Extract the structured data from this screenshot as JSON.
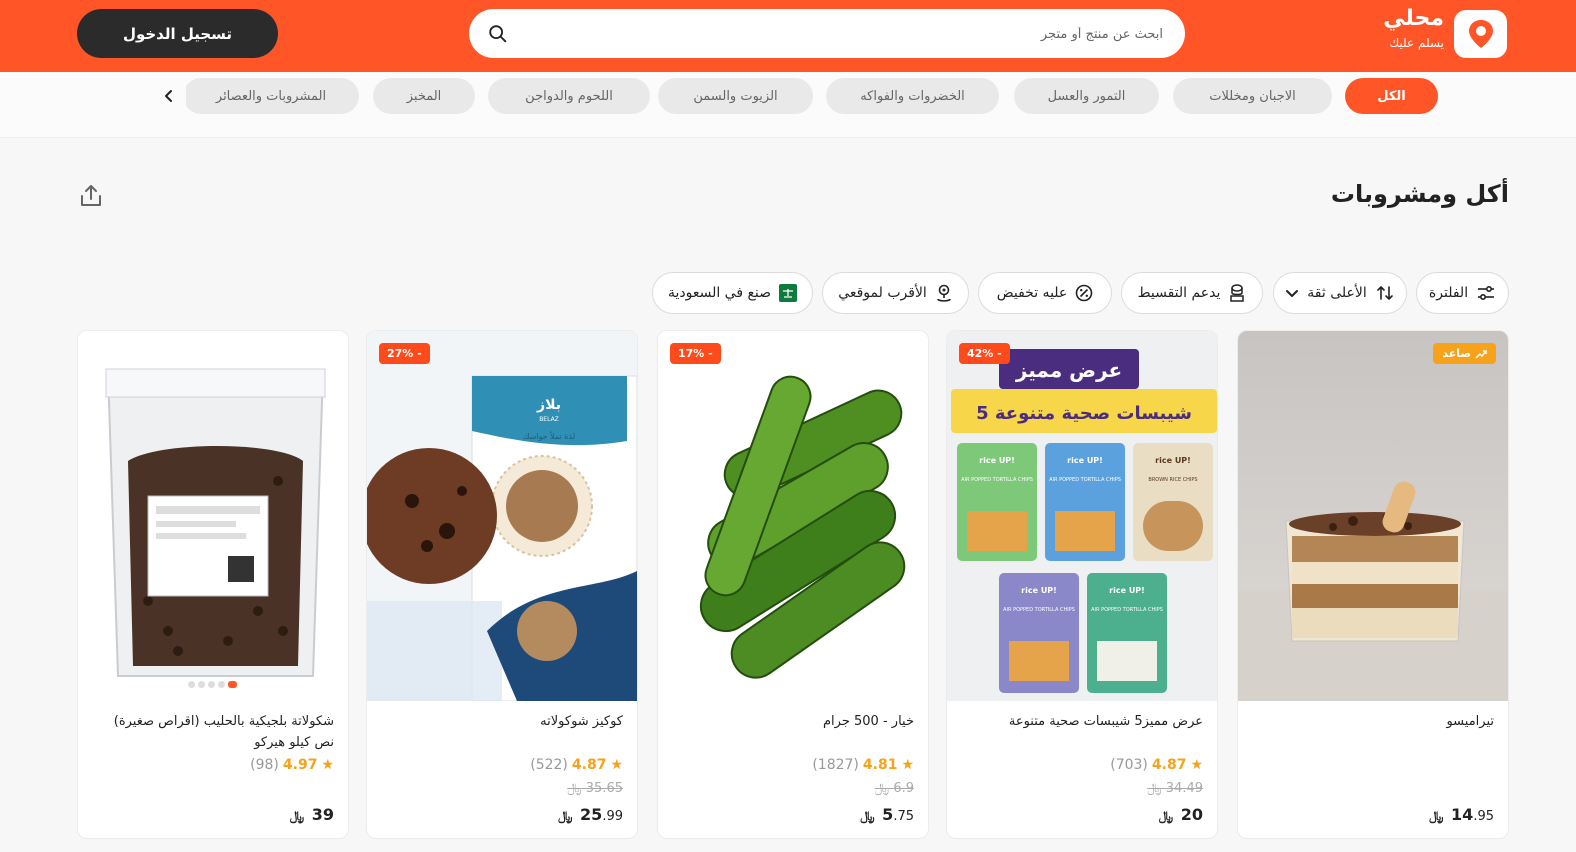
{
  "header": {
    "login_label": "تسجيل الدخول",
    "search_placeholder": "ابحث عن منتج أو متجر",
    "brand_name": "محلي",
    "brand_tagline": "يسلم عليك",
    "brand_color": "#ff5527"
  },
  "categories": [
    {
      "label": "الكل",
      "active": true
    },
    {
      "label": "الاجبان ومخللات"
    },
    {
      "label": "التمور والعسل"
    },
    {
      "label": "الخضروات والفواكه"
    },
    {
      "label": "الزيوت والسمن"
    },
    {
      "label": "اللحوم والدواجن"
    },
    {
      "label": "المخبز"
    },
    {
      "label": "المشروبات والعصائر"
    }
  ],
  "page": {
    "title": "أكل ومشروبات"
  },
  "filters": [
    {
      "label": "الفلترة",
      "icon": "sliders-icon"
    },
    {
      "label": "الأعلى ثقة",
      "icon": "sort-icon"
    },
    {
      "label": "يدعم التقسيط",
      "icon": "installments-icon"
    },
    {
      "label": "عليه تخفيض",
      "icon": "percent-icon"
    },
    {
      "label": "الأقرب لموقعي",
      "icon": "location-icon"
    },
    {
      "label": "صنع في السعودية",
      "icon": "saudi-flag-icon"
    }
  ],
  "products": [
    {
      "name": "تيراميسو",
      "price_main": "14",
      "price_frac": ".95",
      "badge": "صاعد",
      "rating": "",
      "reviews": "",
      "old_price": ""
    },
    {
      "name": "عرض مميز5 شيبسات صحية متنوعة",
      "price_main": "20",
      "price_frac": "",
      "discount": "42% -",
      "rating": "4.87",
      "reviews": "(703)",
      "old_price": "34.49"
    },
    {
      "name": "خيار - 500 جرام",
      "price_main": "5",
      "price_frac": ".75",
      "discount": "17% -",
      "rating": "4.81",
      "reviews": "(1827)",
      "old_price": "6.9"
    },
    {
      "name": "كوكيز شوكولاته",
      "price_main": "25",
      "price_frac": ".99",
      "discount": "27% -",
      "rating": "4.87",
      "reviews": "(522)",
      "old_price": "35.65"
    },
    {
      "name": "شكولاتة بلجيكية بالحليب (اقراص صغيرة) نص كيلو هيركو",
      "price_main": "39",
      "price_frac": "",
      "rating": "4.97",
      "reviews": "(98)",
      "old_price": ""
    }
  ],
  "promo_art": {
    "banner_top": "عرض مميز",
    "banner_sub": "5 شيبسات صحية متنوعة",
    "pack_brand": "rice UP!",
    "pack_labels": [
      "AIR POPPED TORTILLA CHIPS",
      "BROWN RICE CHIPS"
    ],
    "cookie_brand": "بلاز",
    "cookie_brand_latin": "BELAZ",
    "cookie_tagline": "لذة تملأ حواسك"
  },
  "currency_symbol": "﷼"
}
